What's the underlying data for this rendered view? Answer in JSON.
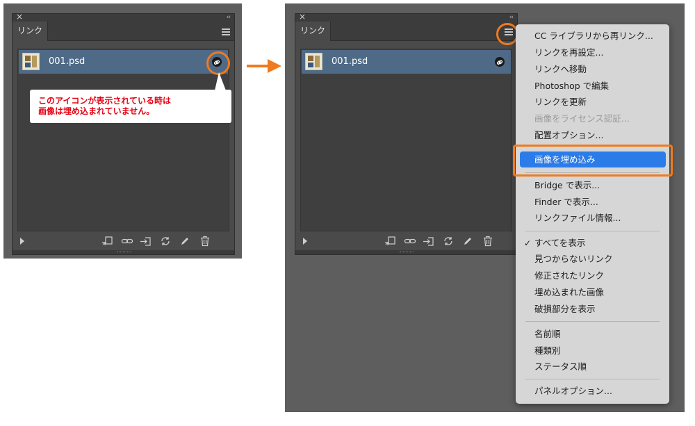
{
  "colors": {
    "accent_orange": "#f07a1e",
    "callout_red": "#e60012",
    "selected_row": "#4f6a86",
    "menu_highlight": "#2b7ce8",
    "panel_bg": "#4a4a4a"
  },
  "left_panel": {
    "close_icon": "×",
    "collapse_icon": "‹‹",
    "tab_label": "リンク",
    "file_name": "001.psd",
    "callout_line1": "このアイコンが表示されている時は",
    "callout_line2": "画像は埋め込まれていません。"
  },
  "right_panel": {
    "close_icon": "×",
    "collapse_icon": "‹‹",
    "tab_label": "リンク",
    "file_name": "001.psd"
  },
  "toolbar_icons": [
    "relink-cc-library-icon",
    "relink-icon",
    "go-to-link-icon",
    "update-link-icon",
    "edit-original-icon",
    "trash-icon"
  ],
  "menu": {
    "items": [
      {
        "label": "CC ライブラリから再リンク..."
      },
      {
        "label": "リンクを再設定..."
      },
      {
        "label": "リンクへ移動"
      },
      {
        "label": "Photoshop で編集"
      },
      {
        "label": "リンクを更新"
      },
      {
        "label": "画像をライセンス認証..."
      },
      {
        "label": "配置オプション..."
      },
      {
        "label": "画像を埋め込み"
      },
      {
        "label": "Bridge で表示..."
      },
      {
        "label": "Finder で表示..."
      },
      {
        "label": "リンクファイル情報..."
      },
      {
        "label": "すべてを表示"
      },
      {
        "label": "見つからないリンク"
      },
      {
        "label": "修正されたリンク"
      },
      {
        "label": "埋め込まれた画像"
      },
      {
        "label": "破損部分を表示"
      },
      {
        "label": "名前順"
      },
      {
        "label": "種類別"
      },
      {
        "label": "ステータス順"
      },
      {
        "label": "パネルオプション..."
      }
    ],
    "checkmark": "✓"
  }
}
